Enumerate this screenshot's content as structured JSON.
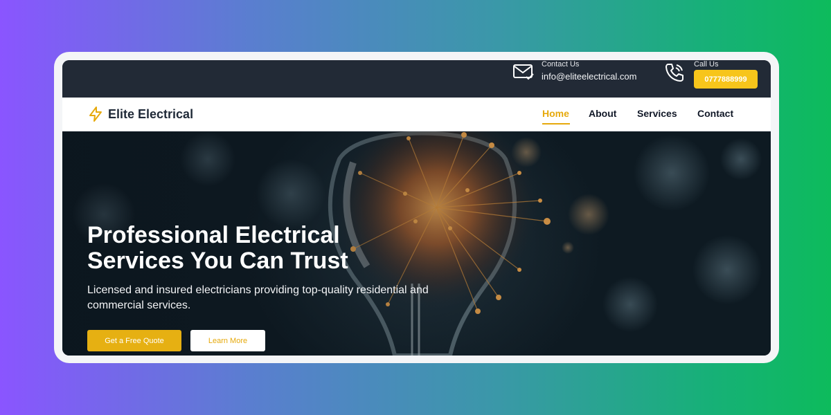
{
  "colors": {
    "accent": "#e6a90b",
    "call_button": "#f7c51b",
    "topbar": "#222a36",
    "text_dark": "#1f2937"
  },
  "topbar": {
    "contact_label": "Contact Us",
    "contact_email": "info@eliteelectrical.com",
    "contact_icon": "mail-check-icon",
    "call_label": "Call Us",
    "call_number": "0777888999",
    "call_icon": "phone-icon"
  },
  "navbar": {
    "logo_icon": "lightning-bolt-icon",
    "brand": "Elite Electrical",
    "items": [
      {
        "label": "Home",
        "active": true
      },
      {
        "label": "About",
        "active": false
      },
      {
        "label": "Services",
        "active": false
      },
      {
        "label": "Contact",
        "active": false
      }
    ]
  },
  "hero": {
    "title_line1": "Professional Electrical",
    "title_line2": "Services You Can Trust",
    "subtitle": "Licensed and insured electricians providing top-quality residential and commercial services.",
    "primary_button": "Get a Free Quote",
    "secondary_button": "Learn More",
    "background": "glowing-light-bulb-image"
  }
}
